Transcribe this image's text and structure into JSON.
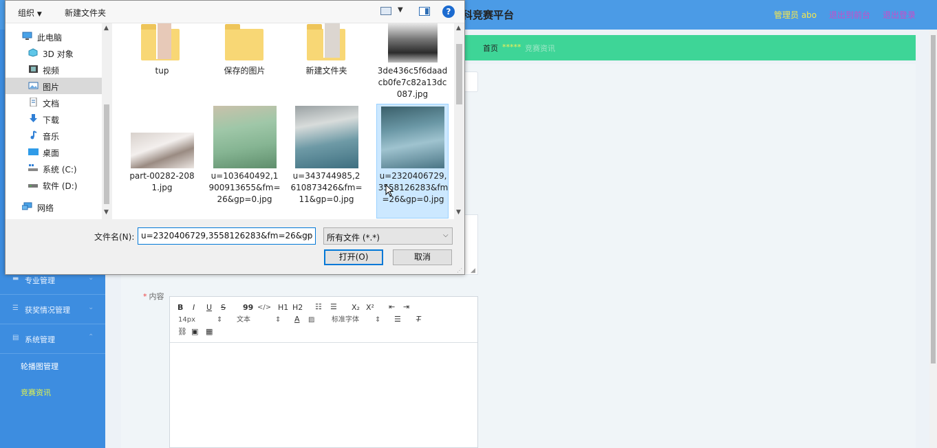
{
  "app": {
    "brand": "科竞赛平台",
    "admin": "管理员 abo",
    "to_front": "退出到前台",
    "logout": "退出登录"
  },
  "breadcrumb": {
    "home": "首页",
    "sep": "*****",
    "current": "竞赛资讯"
  },
  "sidebar": {
    "items": [
      {
        "label": "专业管理"
      },
      {
        "label": "获奖情况管理"
      },
      {
        "label": "系统管理"
      }
    ],
    "subitems": [
      {
        "label": "轮播图管理"
      },
      {
        "label": "竞赛资讯"
      }
    ]
  },
  "form": {
    "content_label": "内容",
    "required_mark": "*"
  },
  "editor": {
    "toolbar": {
      "bold": "B",
      "italic": "I",
      "underline": "U",
      "strike": "S",
      "quote": "99",
      "code": "</>",
      "h1": "H1",
      "h2": "H2",
      "sub": "X₂",
      "sup": "X²",
      "font_size": "14px",
      "text_type": "文本",
      "font_family": "标准字体"
    }
  },
  "dialog": {
    "toolbar": {
      "organize": "组织",
      "new_folder": "新建文件夹",
      "help": "?"
    },
    "nav": [
      {
        "label": "此电脑"
      },
      {
        "label": "3D 对象"
      },
      {
        "label": "视频"
      },
      {
        "label": "图片"
      },
      {
        "label": "文档"
      },
      {
        "label": "下载"
      },
      {
        "label": "音乐"
      },
      {
        "label": "桌面"
      },
      {
        "label": "系统 (C:)"
      },
      {
        "label": "软件 (D:)"
      },
      {
        "label": "网络"
      }
    ],
    "files": [
      {
        "name": "tup"
      },
      {
        "name": "保存的图片"
      },
      {
        "name": "新建文件夹"
      },
      {
        "name": "3de436c5f6daadcb0fe7c82a13dc087.jpg"
      },
      {
        "name": "part-00282-2081.jpg"
      },
      {
        "name": "u=103640492,1900913655&fm=26&gp=0.jpg"
      },
      {
        "name": "u=343744985,2610873426&fm=11&gp=0.jpg"
      },
      {
        "name": "u=2320406729,3558126283&fm=26&gp=0.jpg"
      }
    ],
    "filename_label": "文件名(N):",
    "filename_value": "u=2320406729,3558126283&fm=26&gp",
    "filetype_value": "所有文件 (*.*)",
    "open_button": "打开(O)",
    "cancel_button": "取消"
  },
  "colors": {
    "topbar": "#4b9be6",
    "sidebar": "#3d8de0",
    "breadcrumb_bar": "#3ed597",
    "selection": "#cce8ff",
    "accent_blue": "#0078d7"
  }
}
